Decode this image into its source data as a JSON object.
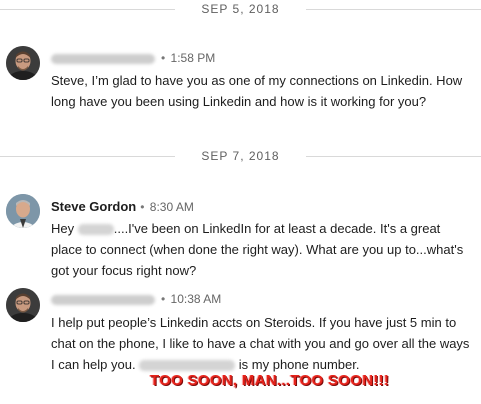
{
  "conversation": {
    "dividers": [
      {
        "label": "SEP 5, 2018"
      },
      {
        "label": "SEP 7, 2018"
      }
    ],
    "messages": [
      {
        "sender": "",
        "sender_redacted": true,
        "time": "1:58 PM",
        "text": "Steve, I’m glad to have you as one of my connections on Linkedin. How long have you been using Linkedin and how is it working for you?"
      },
      {
        "sender": "Steve Gordon",
        "time": "8:30 AM",
        "text_before": "Hey ",
        "text_after": "....I've been on LinkedIn for at least a decade. It's a great place to connect (when done the right way). What are you up to...what's got your focus right now?"
      },
      {
        "sender": "",
        "sender_redacted": true,
        "time": "10:38 AM",
        "text_before": "I help put people’s Linkedin accts on Steroids. If you have just 5 min to chat on the phone, I like to have a chat with you and go over all the ways I can help you. ",
        "text_after": " is my phone number."
      }
    ],
    "time_separator": "•"
  },
  "annotation": {
    "text": "TOO SOON, MAN...TOO SOON!!!",
    "color": "#e5231b"
  },
  "icons": {
    "avatar_other": "person-photo-icon",
    "avatar_steve": "person-photo-icon"
  }
}
